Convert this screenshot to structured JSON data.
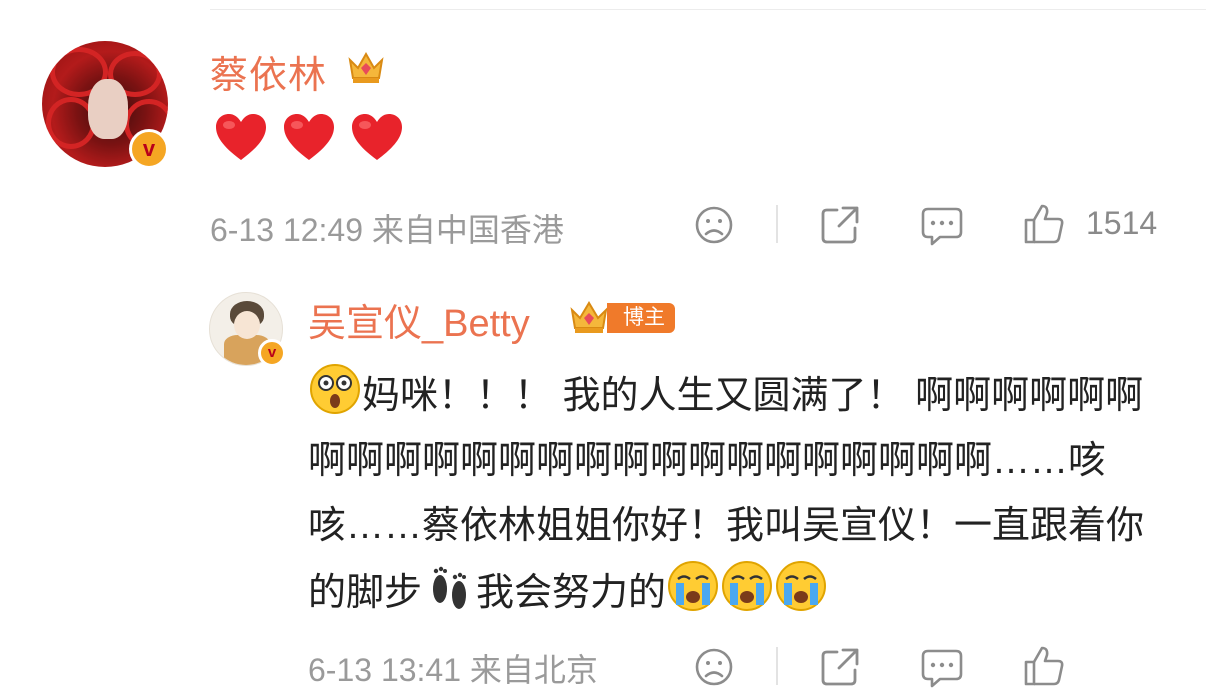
{
  "comment": {
    "author": "蔡依林",
    "content_emojis": [
      "red-heart",
      "red-heart",
      "red-heart"
    ],
    "date": "6-13 12:49",
    "location": "来自中国香港",
    "like_count": "1514"
  },
  "reply": {
    "author": "吴宣仪_Betty",
    "badge": "博主",
    "text_1": "妈咪！！！ 我的人生又圆满了！ 啊啊啊啊啊啊啊啊啊啊啊啊啊啊啊啊啊啊啊啊啊啊啊啊……咳咳……蔡依林姐姐你好！我叫吴宣仪！一直跟着你的脚步",
    "text_2": "我会努力的",
    "date": "6-13 13:41",
    "location": "来自北京"
  },
  "colors": {
    "name": "#eb7350",
    "meta": "#9a9a9a",
    "badge": "#f07a2a"
  }
}
